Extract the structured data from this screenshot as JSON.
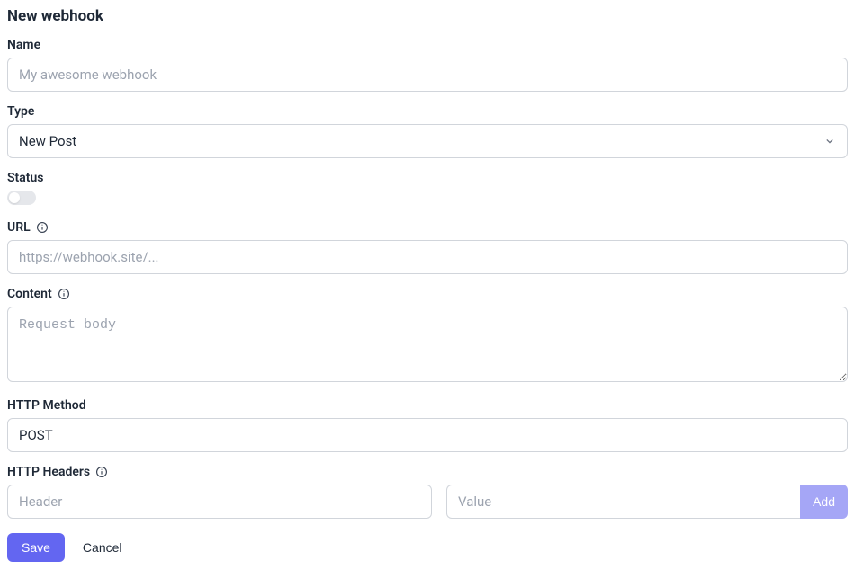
{
  "title": "New webhook",
  "fields": {
    "name": {
      "label": "Name",
      "placeholder": "My awesome webhook",
      "value": ""
    },
    "type": {
      "label": "Type",
      "value": "New Post"
    },
    "status": {
      "label": "Status",
      "value": false
    },
    "url": {
      "label": "URL",
      "placeholder": "https://webhook.site/...",
      "value": ""
    },
    "content": {
      "label": "Content",
      "placeholder": "Request body",
      "value": ""
    },
    "http_method": {
      "label": "HTTP Method",
      "value": "POST"
    },
    "http_headers": {
      "label": "HTTP Headers",
      "header_placeholder": "Header",
      "value_placeholder": "Value",
      "add_label": "Add"
    }
  },
  "actions": {
    "save": "Save",
    "cancel": "Cancel"
  }
}
